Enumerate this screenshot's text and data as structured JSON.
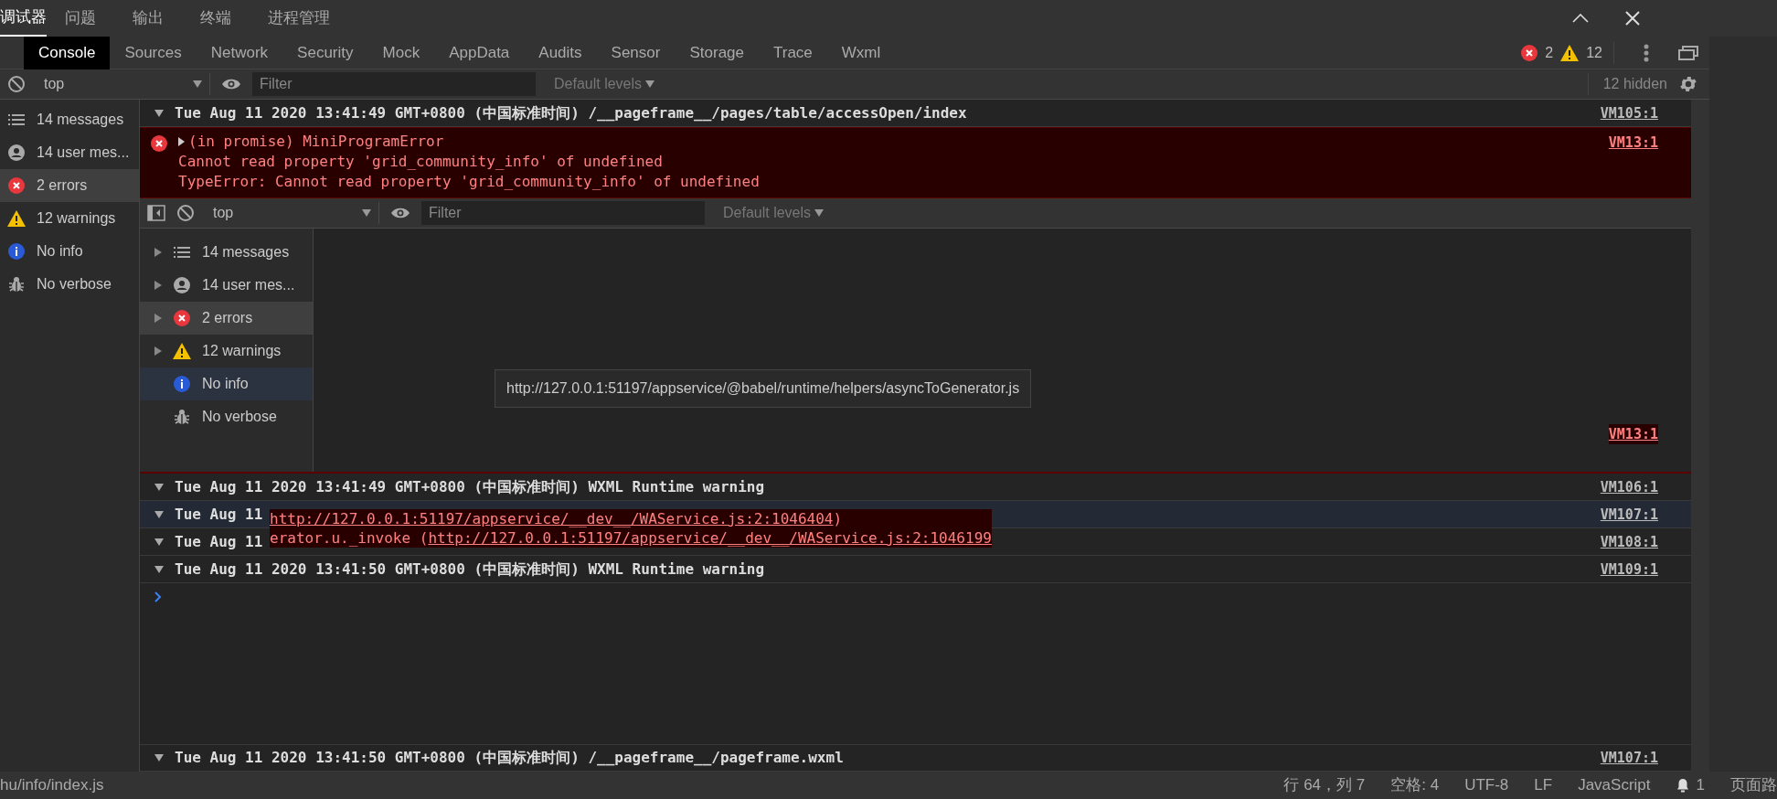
{
  "panel_tabs": [
    {
      "label": "调试器",
      "selected": true
    },
    {
      "label": "问题",
      "selected": false
    },
    {
      "label": "输出",
      "selected": false
    },
    {
      "label": "终端",
      "selected": false
    },
    {
      "label": "进程管理",
      "selected": false
    }
  ],
  "devtools_tabs": [
    {
      "label": "Console",
      "selected": true
    },
    {
      "label": "Sources",
      "selected": false
    },
    {
      "label": "Network",
      "selected": false
    },
    {
      "label": "Security",
      "selected": false
    },
    {
      "label": "Mock",
      "selected": false
    },
    {
      "label": "AppData",
      "selected": false
    },
    {
      "label": "Audits",
      "selected": false
    },
    {
      "label": "Sensor",
      "selected": false
    },
    {
      "label": "Storage",
      "selected": false
    },
    {
      "label": "Trace",
      "selected": false
    },
    {
      "label": "Wxml",
      "selected": false
    }
  ],
  "counts": {
    "errors": "2",
    "warnings": "12"
  },
  "toolbar": {
    "context": "top",
    "filter_placeholder": "Filter",
    "levels": "Default levels",
    "hidden": "12 hidden"
  },
  "sidebar": [
    {
      "kind": "messages",
      "label": "14 messages",
      "selected": false
    },
    {
      "kind": "user",
      "label": "14 user mes...",
      "selected": false
    },
    {
      "kind": "errors",
      "label": "2 errors",
      "selected": true
    },
    {
      "kind": "warnings",
      "label": "12 warnings",
      "selected": false
    },
    {
      "kind": "info",
      "label": "No info",
      "selected": false
    },
    {
      "kind": "verbose",
      "label": "No verbose",
      "selected": false
    }
  ],
  "group_header": {
    "text": "Tue Aug 11 2020 13:41:49 GMT+0800 (中国标准时间) /__pageframe__/pages/table/accessOpen/index",
    "link": "VM105:1"
  },
  "error": {
    "title": "(in promise) MiniProgramError",
    "lines": [
      "Cannot read property 'grid_community_info' of undefined",
      "TypeError: Cannot read property 'grid_community_info' of undefined"
    ],
    "link": "VM13:1"
  },
  "nested_console": {
    "toolbar": {
      "context": "top",
      "filter_placeholder": "Filter",
      "levels": "Default levels"
    },
    "sidebar": [
      {
        "kind": "messages",
        "label": "14 messages",
        "selected": false,
        "hovered": false
      },
      {
        "kind": "user",
        "label": "14 user mes...",
        "selected": false,
        "hovered": false
      },
      {
        "kind": "errors",
        "label": "2 errors",
        "selected": true,
        "hovered": false
      },
      {
        "kind": "warnings",
        "label": "12 warnings",
        "selected": false,
        "hovered": false
      },
      {
        "kind": "info",
        "label": "No info",
        "selected": false,
        "hovered": true
      },
      {
        "kind": "verbose",
        "label": "No verbose",
        "selected": false,
        "hovered": false
      }
    ],
    "link": "VM13:1"
  },
  "tooltip": "http://127.0.0.1:51197/appservice/@babel/runtime/helpers/asyncToGenerator.js",
  "rows": [
    {
      "text": "Tue Aug 11 2020 13:41:49 GMT+0800 (中国标准时间) WXML Runtime warning",
      "link": "VM106:1",
      "selected": false
    },
    {
      "text": "Tue Aug 11",
      "link": "VM107:1",
      "selected": true
    },
    {
      "text": "Tue Aug 11",
      "link": "VM108:1",
      "selected": false
    },
    {
      "text": "Tue Aug 11 2020 13:41:50 GMT+0800 (中国标准时间) WXML Runtime warning",
      "link": "VM109:1",
      "selected": false
    }
  ],
  "stack_overlay": [
    {
      "url": "http://127.0.0.1:51197/appservice/__dev__/WAService.js:2:1046404",
      "suffix": ")"
    },
    {
      "prefix": "erator.u._invoke (",
      "url": "http://127.0.0.1:51197/appservice/__dev__/WAService.js:2:1046199"
    }
  ],
  "last_row": {
    "text": "Tue Aug 11 2020 13:41:50 GMT+0800 (中国标准时间) /__pageframe__/pageframe.wxml",
    "link": "VM107:1"
  },
  "status_bar": {
    "file": "hu/info/index.js",
    "items": [
      "行 64，列 7",
      "空格: 4",
      "UTF-8",
      "LF",
      "JavaScript"
    ],
    "notifications": "1",
    "cut_item": "页面路"
  }
}
